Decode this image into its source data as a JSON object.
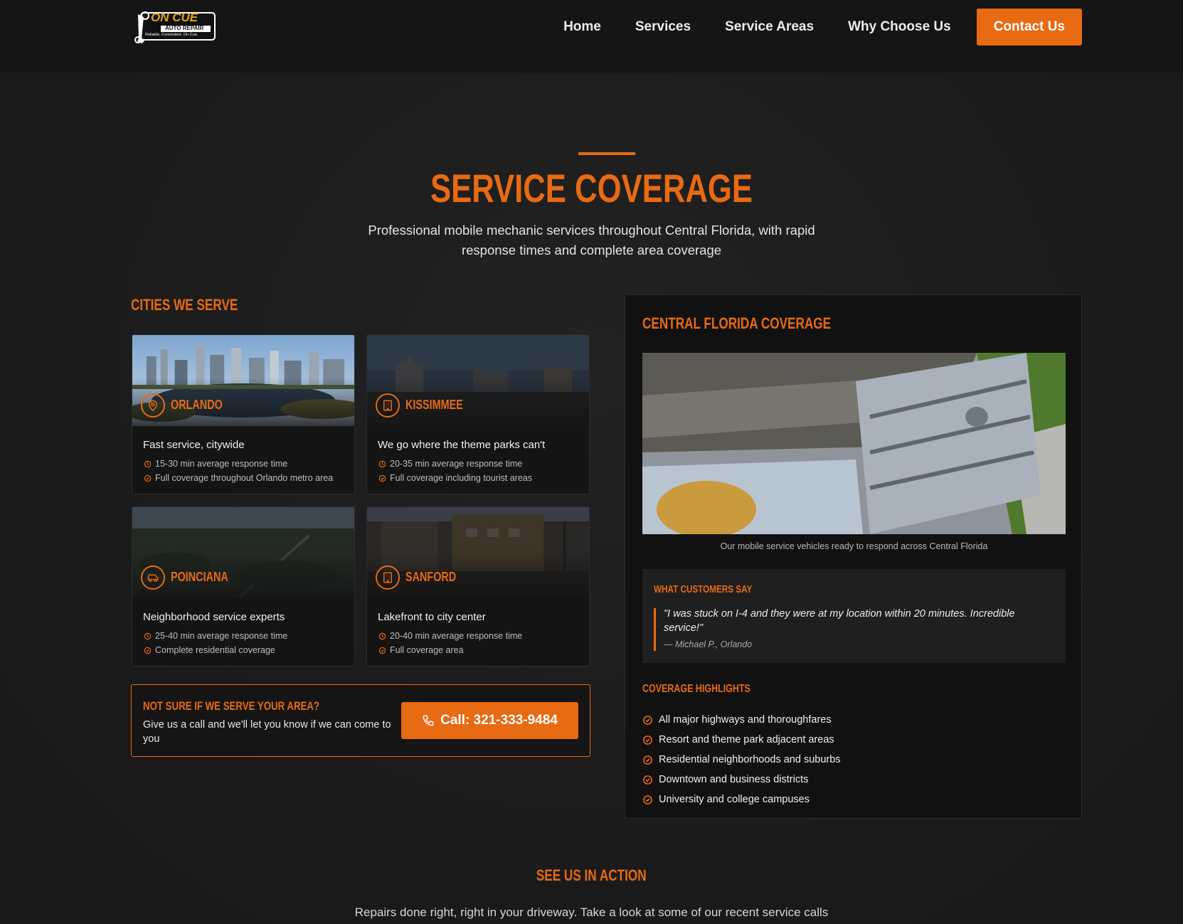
{
  "header": {
    "logo": {
      "brand": "ON CUE",
      "sub": "AUTO REPAIR",
      "tagline": "Reliable. Convenient. On Cue."
    },
    "nav": [
      "Home",
      "Services",
      "Service Areas",
      "Why Choose Us"
    ],
    "cta": "Contact Us"
  },
  "hero": {
    "title": "SERVICE COVERAGE",
    "subtitle": "Professional mobile mechanic services throughout Central Florida, with rapid response times and complete area coverage"
  },
  "cities": {
    "heading": "CITIES WE SERVE",
    "items": [
      {
        "name": "ORLANDO",
        "icon": "map-pin-icon",
        "tagline": "Fast service, citywide",
        "response": "15-30 min average response time",
        "coverage": "Full coverage throughout Orlando metro area"
      },
      {
        "name": "KISSIMMEE",
        "icon": "building-icon",
        "tagline": "We go where the theme parks can't",
        "response": "20-35 min average response time",
        "coverage": "Full coverage including tourist areas"
      },
      {
        "name": "POINCIANA",
        "icon": "car-icon",
        "tagline": "Neighborhood service experts",
        "response": "25-40 min average response time",
        "coverage": "Complete residential coverage"
      },
      {
        "name": "SANFORD",
        "icon": "building-icon",
        "tagline": "Lakefront to city center",
        "response": "20-40 min average response time",
        "coverage": "Full coverage area"
      }
    ]
  },
  "not_sure": {
    "heading": "NOT SURE IF WE SERVE YOUR AREA?",
    "text": "Give us a call and we'll let you know if we can come to you",
    "call_button": "Call: 321-333-9484"
  },
  "coverage_panel": {
    "heading": "CENTRAL FLORIDA COVERAGE",
    "caption": "Our mobile service vehicles ready to respond across Central Florida",
    "testimonial": {
      "heading": "WHAT CUSTOMERS SAY",
      "quote": "\"I was stuck on I-4 and they were at my location within 20 minutes. Incredible service!\"",
      "author": "— Michael P., Orlando"
    },
    "highlights_heading": "COVERAGE HIGHLIGHTS",
    "highlights": [
      "All major highways and thoroughfares",
      "Resort and theme park adjacent areas",
      "Residential neighborhoods and suburbs",
      "Downtown and business districts",
      "University and college campuses"
    ]
  },
  "see_us": {
    "heading": "SEE US IN ACTION",
    "subtitle": "Repairs done right, right in your driveway. Take a look at some of our recent service calls"
  },
  "colors": {
    "accent": "#e86a12",
    "background": "#1c1c1c",
    "card": "#141414"
  }
}
